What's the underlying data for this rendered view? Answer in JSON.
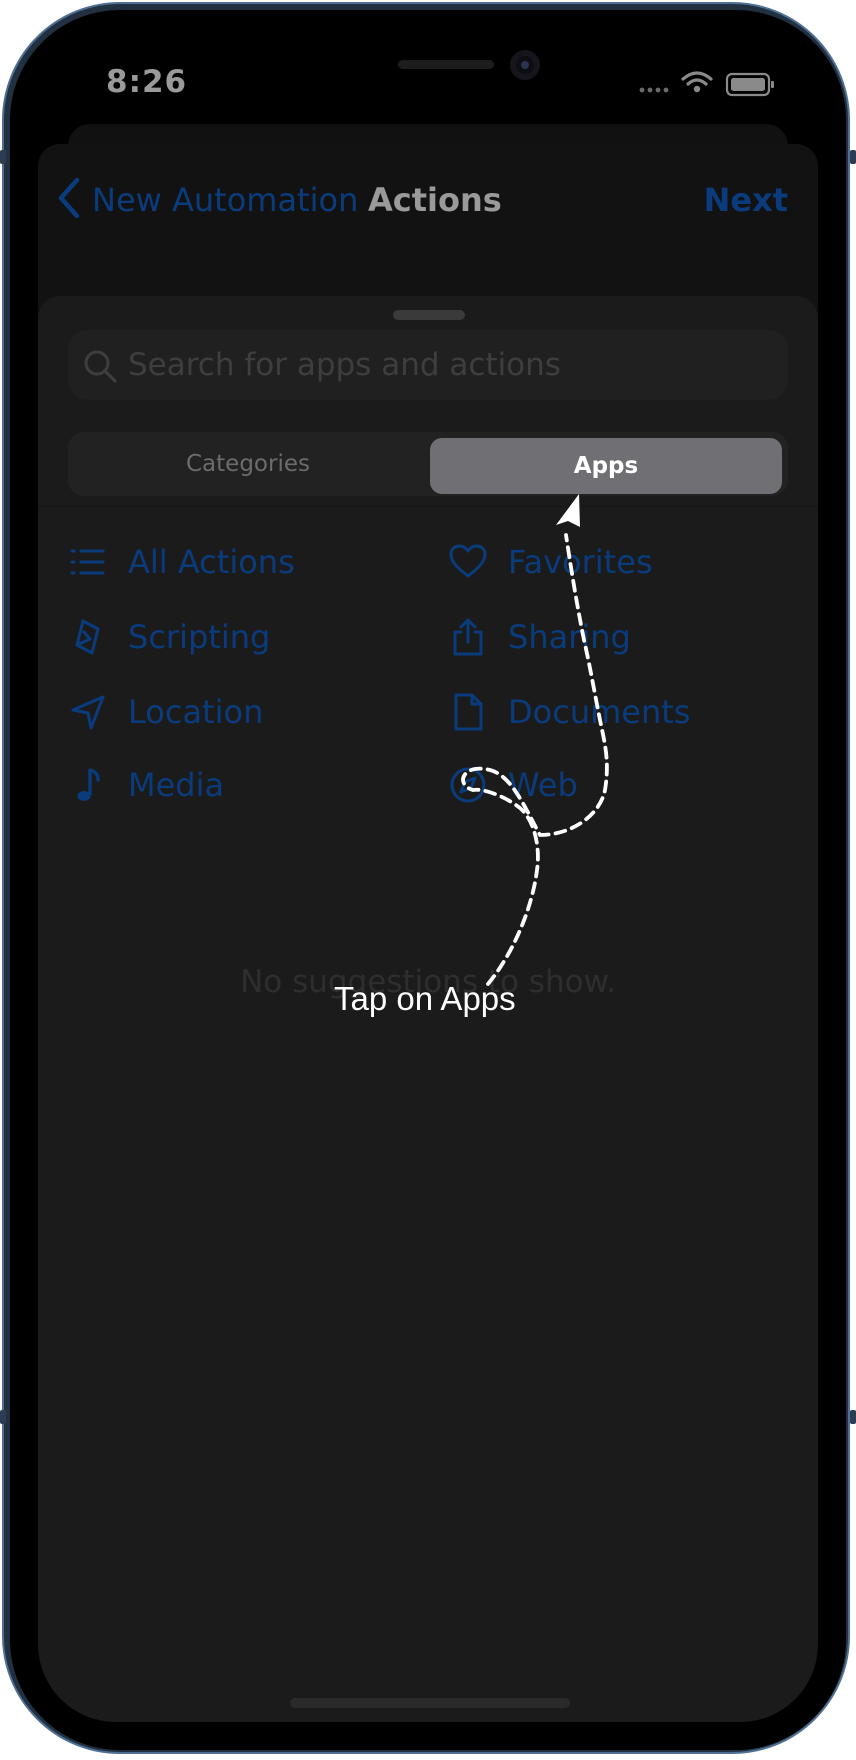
{
  "status_bar": {
    "time": "8:26"
  },
  "nav": {
    "back_label": "New Automation",
    "title": "Actions",
    "next_label": "Next"
  },
  "search": {
    "placeholder": "Search for apps and actions"
  },
  "segments": {
    "categories": "Categories",
    "apps": "Apps",
    "selected": "Apps"
  },
  "categories": [
    {
      "label": "All Actions",
      "icon": "list-icon"
    },
    {
      "label": "Favorites",
      "icon": "heart-icon"
    },
    {
      "label": "Scripting",
      "icon": "scripting-icon"
    },
    {
      "label": "Sharing",
      "icon": "share-icon"
    },
    {
      "label": "Location",
      "icon": "location-arrow-icon"
    },
    {
      "label": "Documents",
      "icon": "document-icon"
    },
    {
      "label": "Media",
      "icon": "music-note-icon"
    },
    {
      "label": "Web",
      "icon": "compass-icon"
    }
  ],
  "suggestions": {
    "empty_text": "No suggestions to show."
  },
  "annotation": {
    "text": "Tap on Apps"
  },
  "colors": {
    "accent_dimmed": "#0a3c7d",
    "selected_segment": "#707074"
  }
}
